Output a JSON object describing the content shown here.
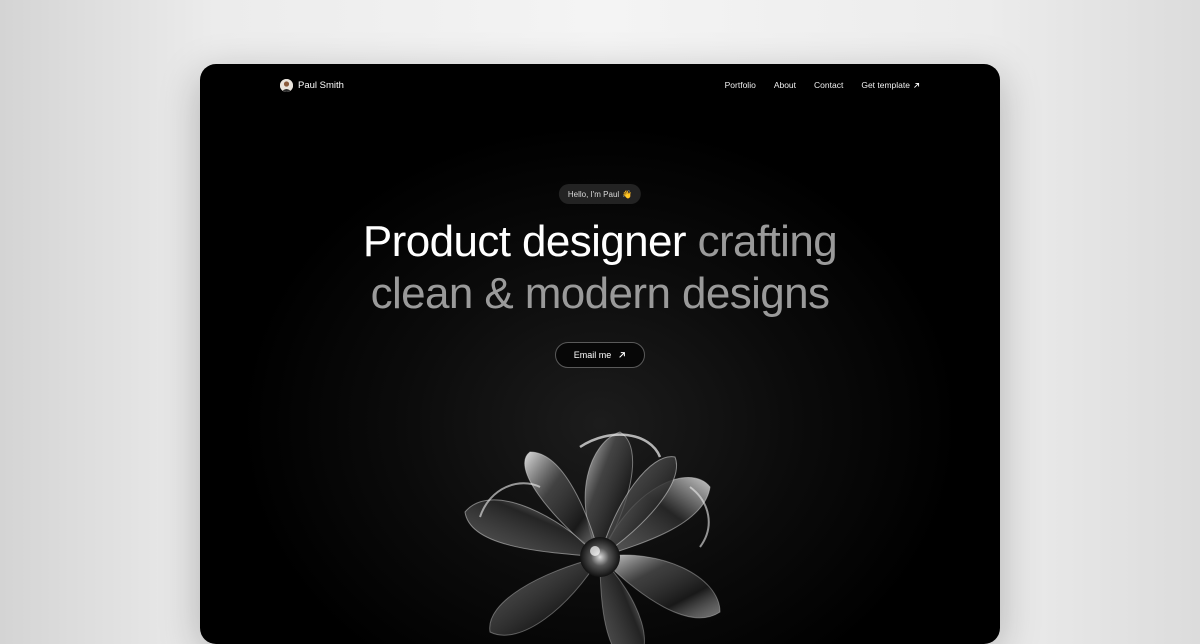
{
  "nav": {
    "brand_name": "Paul Smith",
    "avatar_icon": "profile-photo",
    "links": [
      {
        "label": "Portfolio"
      },
      {
        "label": "About"
      },
      {
        "label": "Contact"
      },
      {
        "label": "Get template",
        "icon": "arrow-up-right-icon"
      }
    ]
  },
  "hero": {
    "greeting": "Hello, I'm Paul",
    "greeting_icon": "👋",
    "headline_strong": "Product designer",
    "headline_muted_1": "crafting",
    "headline_muted_2": "clean & modern designs",
    "cta_label": "Email me",
    "cta_icon": "arrow-up-right-icon"
  },
  "colors": {
    "background": "#000000",
    "text_primary": "#ffffff",
    "text_muted": "#9a9a9a",
    "pill_bg": "#232323"
  }
}
